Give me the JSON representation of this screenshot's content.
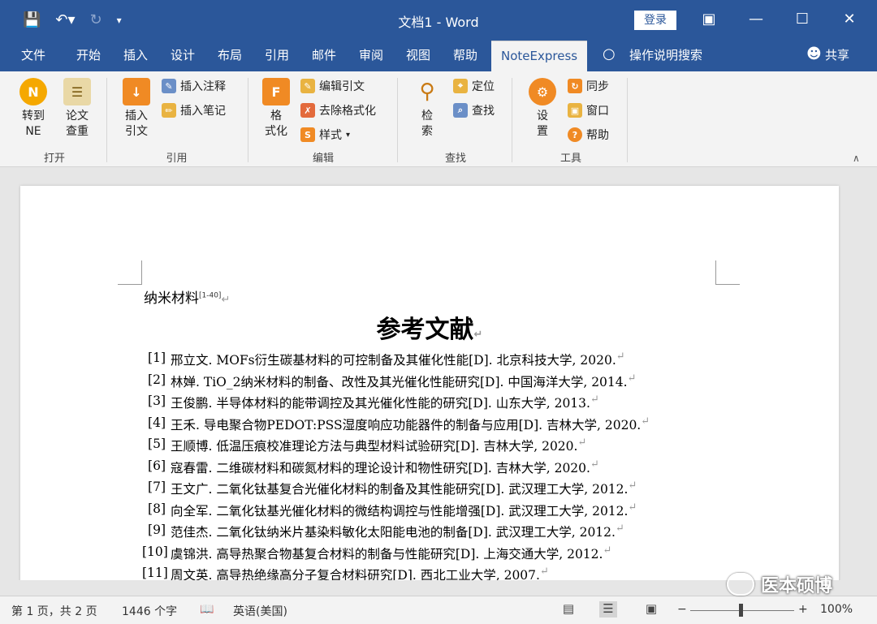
{
  "window": {
    "title": "文档1 - Word",
    "login_label": "登录"
  },
  "qat": {
    "save_icon": "save-icon",
    "undo_icon": "undo-icon",
    "redo_icon": "redo-icon"
  },
  "tabs": [
    {
      "label": "文件"
    },
    {
      "label": "开始"
    },
    {
      "label": "插入"
    },
    {
      "label": "设计"
    },
    {
      "label": "布局"
    },
    {
      "label": "引用"
    },
    {
      "label": "邮件"
    },
    {
      "label": "审阅"
    },
    {
      "label": "视图"
    },
    {
      "label": "帮助"
    },
    {
      "label": "NoteExpress"
    }
  ],
  "tell_me": "操作说明搜索",
  "share": "共享",
  "ribbon": {
    "group_open": {
      "label": "打开",
      "goto_ne": [
        "转到",
        "NE"
      ],
      "check": [
        "论文",
        "查重"
      ]
    },
    "group_cite": {
      "label": "引用",
      "insert_cite": [
        "插入",
        "引文"
      ],
      "insert_note": "插入注释",
      "insert_memo": "插入笔记"
    },
    "group_edit": {
      "label": "编辑",
      "format": [
        "格",
        "式化"
      ],
      "edit_cite": "编辑引文",
      "remove_format": "去除格式化",
      "style": "样式"
    },
    "group_find": {
      "label": "查找",
      "search": [
        "检",
        "索"
      ],
      "locate": "定位",
      "find": "查找"
    },
    "group_tools": {
      "label": "工具",
      "settings": [
        "设",
        "置"
      ],
      "sync": "同步",
      "window": "窗口",
      "help": "帮助"
    }
  },
  "document": {
    "line1": "纳米材料",
    "line1_cite": "[1-40]",
    "heading": "参考文献",
    "references": [
      {
        "num": "[1]",
        "text": "邢立文. MOFs衍生碳基材料的可控制备及其催化性能[D]. 北京科技大学, 2020."
      },
      {
        "num": "[2]",
        "text": "林婵. TiO_2纳米材料的制备、改性及其光催化性能研究[D]. 中国海洋大学, 2014."
      },
      {
        "num": "[3]",
        "text": "王俊鹏. 半导体材料的能带调控及其光催化性能的研究[D]. 山东大学, 2013."
      },
      {
        "num": "[4]",
        "text": "王禾. 导电聚合物PEDOT:PSS湿度响应功能器件的制备与应用[D]. 吉林大学, 2020."
      },
      {
        "num": "[5]",
        "text": "王顺博. 低温压痕校准理论方法与典型材料试验研究[D]. 吉林大学, 2020."
      },
      {
        "num": "[6]",
        "text": "寇春雷. 二维碳材料和碳氮材料的理论设计和物性研究[D]. 吉林大学, 2020."
      },
      {
        "num": "[7]",
        "text": "王文广. 二氧化钛基复合光催化材料的制备及其性能研究[D]. 武汉理工大学, 2012."
      },
      {
        "num": "[8]",
        "text": "向全军. 二氧化钛基光催化材料的微结构调控与性能增强[D]. 武汉理工大学, 2012."
      },
      {
        "num": "[9]",
        "text": "范佳杰. 二氧化钛纳米片基染料敏化太阳能电池的制备[D]. 武汉理工大学, 2012."
      },
      {
        "num": "[10]",
        "text": "虞锦洪. 高导热聚合物基复合材料的制备与性能研究[D]. 上海交通大学, 2012."
      },
      {
        "num": "[11]",
        "text": "周文英. 高导热绝缘高分子复合材料研究[D]. 西北工业大学, 2007."
      }
    ]
  },
  "status": {
    "page": "第 1 页，共 2 页",
    "words": "1446 个字",
    "language": "英语(美国)",
    "zoom_minus": "−",
    "zoom_plus": "+",
    "zoom": "100%",
    "zoom_level_percent": 100
  },
  "watermark": "医本硕博"
}
